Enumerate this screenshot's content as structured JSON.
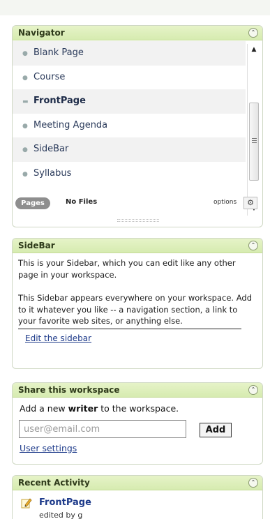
{
  "navigator": {
    "title": "Navigator",
    "collapse_glyph": "⌃",
    "pages": [
      {
        "label": "Blank Page",
        "bold": false
      },
      {
        "label": "Course",
        "bold": false
      },
      {
        "label": "FrontPage",
        "bold": true
      },
      {
        "label": "Meeting Agenda",
        "bold": false
      },
      {
        "label": "SideBar",
        "bold": false
      },
      {
        "label": "Syllabus",
        "bold": false
      }
    ],
    "pages_tab": "Pages",
    "files_tab": "No Files",
    "options_label": "options"
  },
  "sidebar": {
    "title": "SideBar",
    "para1": "This is your Sidebar, which you can edit like any other page in your workspace.",
    "para2": "This Sidebar appears everywhere on your workspace. Add to it whatever you like -- a navigation section, a link to your favorite web sites, or anything else.",
    "edit_link": "Edit the sidebar"
  },
  "share": {
    "title": "Share this workspace",
    "prompt_prefix": "Add a new ",
    "prompt_bold": "writer",
    "prompt_suffix": " to the workspace.",
    "email_placeholder": "user@email.com",
    "add_label": "Add",
    "user_settings": "User settings"
  },
  "recent": {
    "title": "Recent Activity",
    "item_title": "FrontPage",
    "item_sub": "edited by g"
  },
  "icons": {
    "collapse": "chevron-up-icon",
    "gear": "gear-icon",
    "edit": "pencil-icon"
  }
}
